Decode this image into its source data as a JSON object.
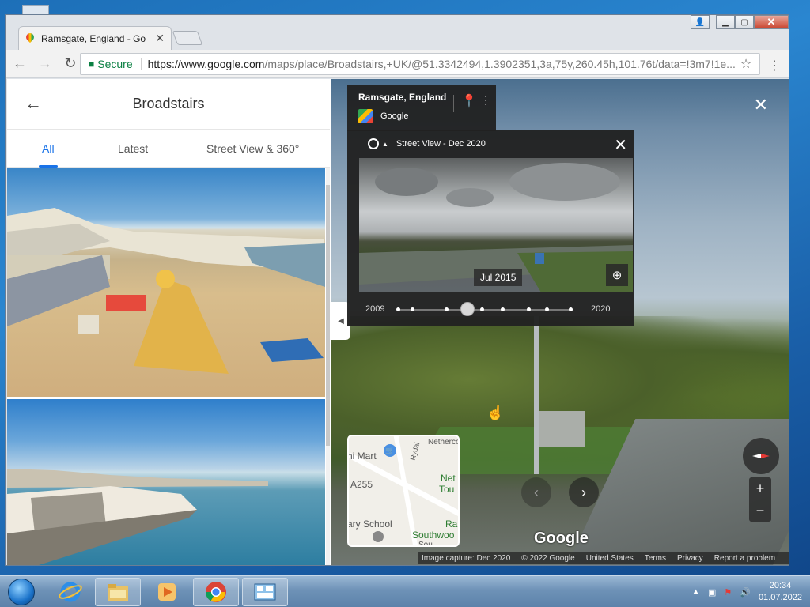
{
  "browser": {
    "tab_title": "Ramsgate, England - Go",
    "tab_close": "✕",
    "secure_label": "Secure",
    "url_main": "https://www.google.com",
    "url_rest": "/maps/place/Broadstairs,+UK/@51.3342494,1.3902351,3a,75y,260.45h,101.76t/data=!3m7!1e...",
    "back": "←",
    "forward": "→",
    "reload": "↻",
    "star": "☆",
    "menu": "⋮",
    "win_user": "👤",
    "win_min": "▁",
    "win_max": "▢",
    "win_close": "✕"
  },
  "left_panel": {
    "back": "←",
    "title": "Broadstairs",
    "tabs": [
      "All",
      "Latest",
      "Street View & 360°"
    ],
    "active_tab": "All"
  },
  "street_view": {
    "location_name": "Ramsgate, England",
    "provider": "Google",
    "close": "✕",
    "time_machine": {
      "header": "Street View - Dec 2020",
      "close": "✕",
      "date_label": "Jul 2015",
      "start_year": "2009",
      "end_year": "2020",
      "zoom": "⊕"
    },
    "collapse": "◀",
    "minimap": {
      "labels": [
        "ni Mart",
        "Rydal",
        "Netherco",
        "Net",
        "Tou",
        "A255",
        "ary School",
        "Ra",
        "Southwoo",
        "Sou"
      ]
    },
    "nav_prev": "‹",
    "nav_next": "›",
    "zoom_in": "+",
    "zoom_out": "−",
    "watermark": "Google",
    "footer": [
      "Image capture: Dec 2020",
      "© 2022 Google",
      "United States",
      "Terms",
      "Privacy",
      "Report a problem"
    ]
  },
  "taskbar": {
    "time": "20:34",
    "date": "01.07.2022",
    "tray_up": "▲",
    "volume": "🔊"
  }
}
